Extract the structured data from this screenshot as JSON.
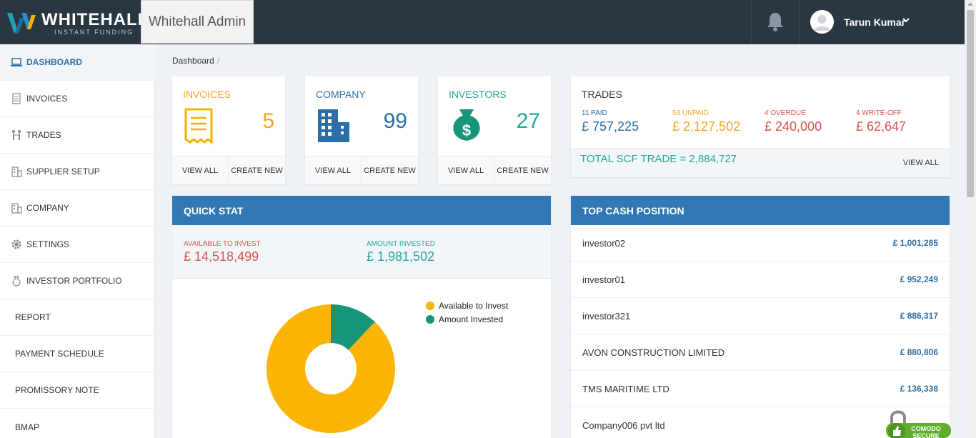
{
  "header": {
    "brand": "WHITEHALL",
    "brand_sub": "INSTANT FUNDING",
    "admin_title": "Whitehall Admin",
    "user_name": "Tarun Kumar"
  },
  "breadcrumb": {
    "current": "Dashboard",
    "separator": "/"
  },
  "sidebar": {
    "items": [
      {
        "label": "DASHBOARD",
        "icon": "laptop-icon"
      },
      {
        "label": "INVOICES",
        "icon": "document-icon"
      },
      {
        "label": "TRADES",
        "icon": "trades-icon"
      },
      {
        "label": "SUPPLIER SETUP",
        "icon": "building-icon"
      },
      {
        "label": "COMPANY",
        "icon": "building-icon"
      },
      {
        "label": "SETTINGS",
        "icon": "gear-icon"
      },
      {
        "label": "INVESTOR PORTFOLIO",
        "icon": "money-bag-icon"
      },
      {
        "label": "REPORT"
      },
      {
        "label": "PAYMENT SCHEDULE"
      },
      {
        "label": "PROMISSORY NOTE"
      },
      {
        "label": "BMAP"
      }
    ]
  },
  "cards": [
    {
      "title": "INVOICES",
      "value": "5",
      "view": "VIEW ALL",
      "create": "CREATE NEW",
      "color": "#f5a623",
      "icon": "receipt-icon"
    },
    {
      "title": "COMPANY",
      "value": "99",
      "view": "VIEW ALL",
      "create": "CREATE NEW",
      "color": "#2c6fa6",
      "icon": "building-icon"
    },
    {
      "title": "INVESTORS",
      "value": "27",
      "view": "VIEW ALL",
      "create": "CREATE NEW",
      "color": "#26a69a",
      "icon": "money-bag-icon"
    }
  ],
  "trades": {
    "title": "TRADES",
    "stats": [
      {
        "label": "11 PAID",
        "amount": "£ 757,225",
        "color": "#2c6fa6"
      },
      {
        "label": "53 UNPAID",
        "amount": "£ 2,127,502",
        "color": "#f5a623"
      },
      {
        "label": "4 OVERDUE",
        "amount": "£ 240,000",
        "color": "#d9534f"
      },
      {
        "label": "4 WRITE-OFF",
        "amount": "£ 62,647",
        "color": "#d9534f"
      }
    ],
    "total": "TOTAL SCF TRADE = 2,884,727",
    "view_all": "VIEW ALL"
  },
  "quick_stat": {
    "title": "QUICK STAT",
    "available_label": "AVAILABLE TO INVEST",
    "available_amount": "£ 14,518,499",
    "invested_label": "AMOUNT INVESTED",
    "invested_amount": "£ 1,981,502"
  },
  "chart_data": {
    "type": "pie",
    "categories": [
      "Available to Invest",
      "Amount Invested"
    ],
    "values": [
      14518499,
      1981502
    ],
    "colors": [
      "#fbb507",
      "#169679"
    ],
    "legend": "top-right"
  },
  "cash_position": {
    "title": "TOP CASH POSITION",
    "rows": [
      {
        "name": "investor02",
        "value": "£ 1,001,285"
      },
      {
        "name": "investor01",
        "value": "£ 952,249"
      },
      {
        "name": "investor321",
        "value": "£ 886,317"
      },
      {
        "name": "AVON CONSTRUCTION LIMITED",
        "value": "£ 880,806"
      },
      {
        "name": "TMS MARITIME LTD",
        "value": "£ 136,338"
      },
      {
        "name": "Company006 pvt ltd",
        "value": ""
      }
    ]
  },
  "badge": {
    "line1": "COMODO",
    "line2": "SECURE"
  }
}
